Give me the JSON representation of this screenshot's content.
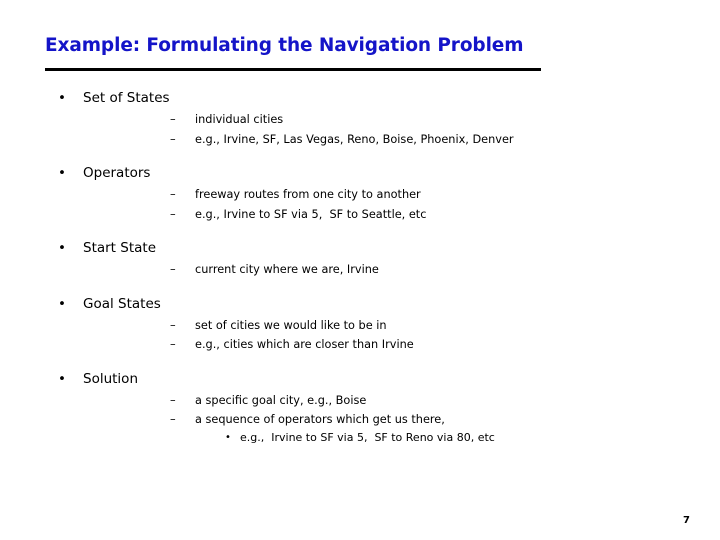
{
  "slide": {
    "title": "Example: Formulating the Navigation Problem",
    "title_color": "#1414C8",
    "rule_color": "#000000",
    "background_color": "#FFFFFF",
    "text_color": "#000000",
    "page_number": "7",
    "bullet_glyph_level1": "•",
    "bullet_glyph_level2": "–",
    "bullet_glyph_level3": "•",
    "sections": [
      {
        "heading": "Set of States",
        "items": [
          {
            "text": "individual cities",
            "subitems": []
          },
          {
            "text": "e.g., Irvine, SF, Las Vegas, Reno, Boise, Phoenix, Denver",
            "subitems": []
          }
        ]
      },
      {
        "heading": "Operators",
        "items": [
          {
            "text": "freeway routes from one city to another",
            "subitems": []
          },
          {
            "text": "e.g., Irvine to SF via 5,  SF to Seattle, etc",
            "subitems": []
          }
        ]
      },
      {
        "heading": "Start State",
        "items": [
          {
            "text": "current city where we are, Irvine",
            "subitems": []
          }
        ]
      },
      {
        "heading": "Goal States",
        "items": [
          {
            "text": "set of cities we would like to be in",
            "subitems": []
          },
          {
            "text": "e.g., cities which are closer than Irvine",
            "subitems": []
          }
        ]
      },
      {
        "heading": "Solution",
        "items": [
          {
            "text": "a specific goal city, e.g., Boise",
            "subitems": []
          },
          {
            "text": "a sequence of operators which get us there,",
            "subitems": [
              {
                "text": "e.g.,  Irvine to SF via 5,  SF to Reno via 80, etc"
              }
            ]
          }
        ]
      }
    ]
  }
}
